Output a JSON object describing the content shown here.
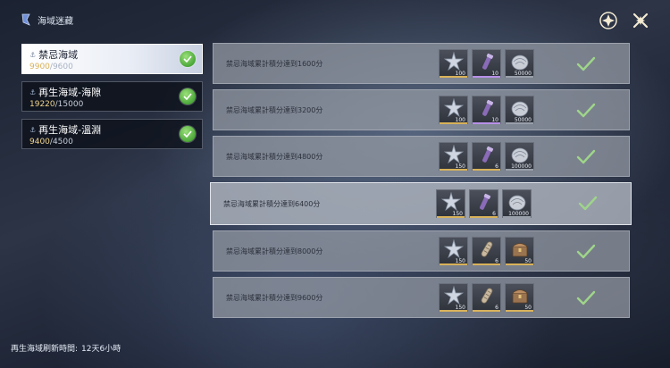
{
  "header": {
    "title": "海域迷藏",
    "logo_icon": "anchor-logo-icon"
  },
  "top_icons": [
    {
      "name": "shop-icon",
      "label": ""
    },
    {
      "name": "close-icon",
      "label": ""
    }
  ],
  "sidebar": {
    "items": [
      {
        "name": "禁忌海域",
        "current": "9900",
        "max": "/9600",
        "completed": true,
        "active": true
      },
      {
        "name": "再生海域-海隙",
        "current": "19220",
        "max": "/15000",
        "completed": true,
        "active": false
      },
      {
        "name": "再生海域-溫淵",
        "current": "9400",
        "max": "/4500",
        "completed": true,
        "active": false
      }
    ]
  },
  "refresh": {
    "label": "再生海域刷新時間:",
    "value": "12天6小時"
  },
  "rows": [
    {
      "requirement": "禁忌海域累計積分達到1600分",
      "highlighted": false,
      "done": true,
      "rewards": [
        {
          "icon": "star-crystal-icon",
          "qty": "100",
          "rarity": "gold"
        },
        {
          "icon": "scroll-icon",
          "qty": "10",
          "rarity": "purple"
        },
        {
          "icon": "shell-coin-icon",
          "qty": "50000",
          "rarity": "grey"
        }
      ]
    },
    {
      "requirement": "禁忌海域累計積分達到3200分",
      "highlighted": false,
      "done": true,
      "rewards": [
        {
          "icon": "star-crystal-icon",
          "qty": "100",
          "rarity": "gold"
        },
        {
          "icon": "scroll-icon",
          "qty": "10",
          "rarity": "purple"
        },
        {
          "icon": "shell-coin-icon",
          "qty": "50000",
          "rarity": "grey"
        }
      ]
    },
    {
      "requirement": "禁忌海域累計積分達到4800分",
      "highlighted": false,
      "done": true,
      "rewards": [
        {
          "icon": "star-crystal-icon",
          "qty": "150",
          "rarity": "gold"
        },
        {
          "icon": "scroll-icon",
          "qty": "6",
          "rarity": "gold"
        },
        {
          "icon": "shell-coin-icon",
          "qty": "100000",
          "rarity": "grey"
        }
      ]
    },
    {
      "requirement": "禁忌海域累計積分達到6400分",
      "highlighted": true,
      "done": true,
      "rewards": [
        {
          "icon": "star-crystal-icon",
          "qty": "150",
          "rarity": "gold"
        },
        {
          "icon": "scroll-icon",
          "qty": "6",
          "rarity": "gold"
        },
        {
          "icon": "shell-coin-icon",
          "qty": "100000",
          "rarity": "grey"
        }
      ]
    },
    {
      "requirement": "禁忌海域累計積分達到8000分",
      "highlighted": false,
      "done": true,
      "rewards": [
        {
          "icon": "star-crystal-icon",
          "qty": "150",
          "rarity": "gold"
        },
        {
          "icon": "bone-scroll-icon",
          "qty": "6",
          "rarity": "gold"
        },
        {
          "icon": "treasure-chest-icon",
          "qty": "50",
          "rarity": "gold"
        }
      ]
    },
    {
      "requirement": "禁忌海域累計積分達到9600分",
      "highlighted": false,
      "done": true,
      "rewards": [
        {
          "icon": "star-crystal-icon",
          "qty": "150",
          "rarity": "gold"
        },
        {
          "icon": "bone-scroll-icon",
          "qty": "6",
          "rarity": "gold"
        },
        {
          "icon": "treasure-chest-icon",
          "qty": "50",
          "rarity": "gold"
        }
      ]
    }
  ],
  "colors": {
    "check_green": "#9fd58a",
    "accent_gold": "#d8b25a"
  }
}
